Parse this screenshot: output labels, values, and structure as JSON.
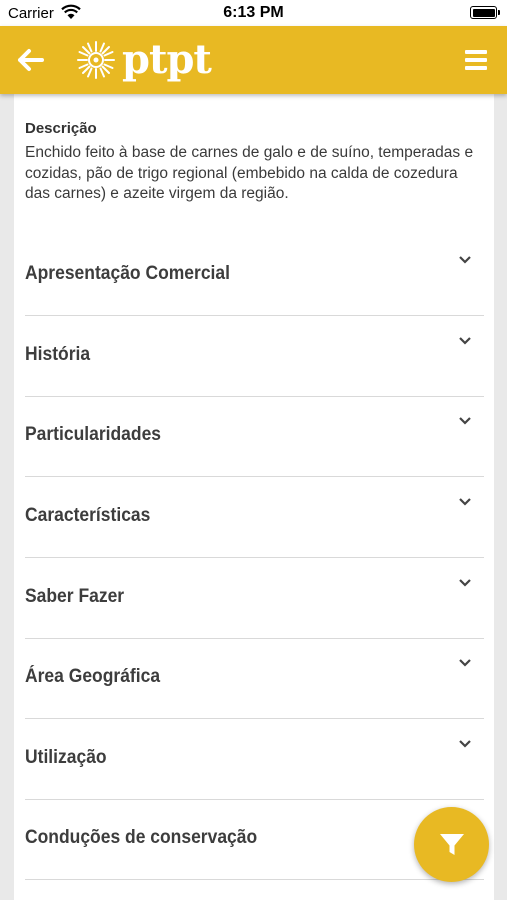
{
  "status_bar": {
    "carrier": "Carrier",
    "time": "6:13 PM"
  },
  "header": {
    "logo_text": "ptpt",
    "back_icon": "arrow-left-icon",
    "menu_icon": "hamburger-menu-icon"
  },
  "description": {
    "label": "Descrição",
    "text": "Enchido feito à base de carnes de galo e de suíno, temperadas e cozidas, pão de trigo regional (embebido na calda de cozedura das carnes) e azeite virgem da região."
  },
  "sections": [
    {
      "label": "Apresentação Comercial"
    },
    {
      "label": "História"
    },
    {
      "label": "Particularidades"
    },
    {
      "label": "Características"
    },
    {
      "label": "Saber Fazer"
    },
    {
      "label": "Área Geográfica"
    },
    {
      "label": "Utilização"
    },
    {
      "label": "Conduções de conservação"
    }
  ],
  "fab": {
    "icon": "filter-icon"
  },
  "colors": {
    "accent": "#e8b923",
    "background": "#e9e9e9",
    "text": "#3d3d3d"
  }
}
